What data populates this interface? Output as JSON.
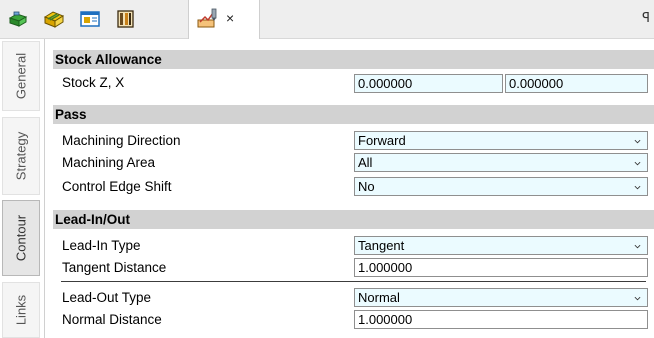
{
  "toolbar": {
    "buttons": [
      {
        "name": "general-icon",
        "color": "#2e8b2e"
      },
      {
        "name": "strategy-icon",
        "color": "#d9a400"
      },
      {
        "name": "layout-icon",
        "color": "#1e6fbf"
      },
      {
        "name": "settings-icon",
        "color": "#6b4a1e"
      },
      {
        "name": "toolpath-icon",
        "color": "#c8801a"
      }
    ],
    "close_glyph": "×",
    "pin_glyph": "ꟼ"
  },
  "sidetabs": [
    {
      "label": "General",
      "active": false
    },
    {
      "label": "Strategy",
      "active": false
    },
    {
      "label": "Contour",
      "active": true
    },
    {
      "label": "Links",
      "active": false
    }
  ],
  "sections": {
    "stock": {
      "title": "Stock Allowance",
      "stock_zx": {
        "label": "Stock Z, X",
        "z": "0.000000",
        "x": "0.000000"
      }
    },
    "pass": {
      "title": "Pass",
      "machining_direction": {
        "label": "Machining Direction",
        "value": "Forward"
      },
      "machining_area": {
        "label": "Machining Area",
        "value": "All"
      },
      "control_edge_shift": {
        "label": "Control Edge Shift",
        "value": "No"
      }
    },
    "leadinout": {
      "title": "Lead-In/Out",
      "lead_in_type": {
        "label": "Lead-In Type",
        "value": "Tangent"
      },
      "tangent_distance": {
        "label": "Tangent Distance",
        "value": "1.000000"
      },
      "lead_out_type": {
        "label": "Lead-Out Type",
        "value": "Normal"
      },
      "normal_distance": {
        "label": "Normal Distance",
        "value": "1.000000"
      }
    }
  },
  "colors": {
    "section_bg": "#d2d2d2",
    "dropdown_bg": "#ebfbff",
    "toolbar_bg": "#eeeeee"
  }
}
